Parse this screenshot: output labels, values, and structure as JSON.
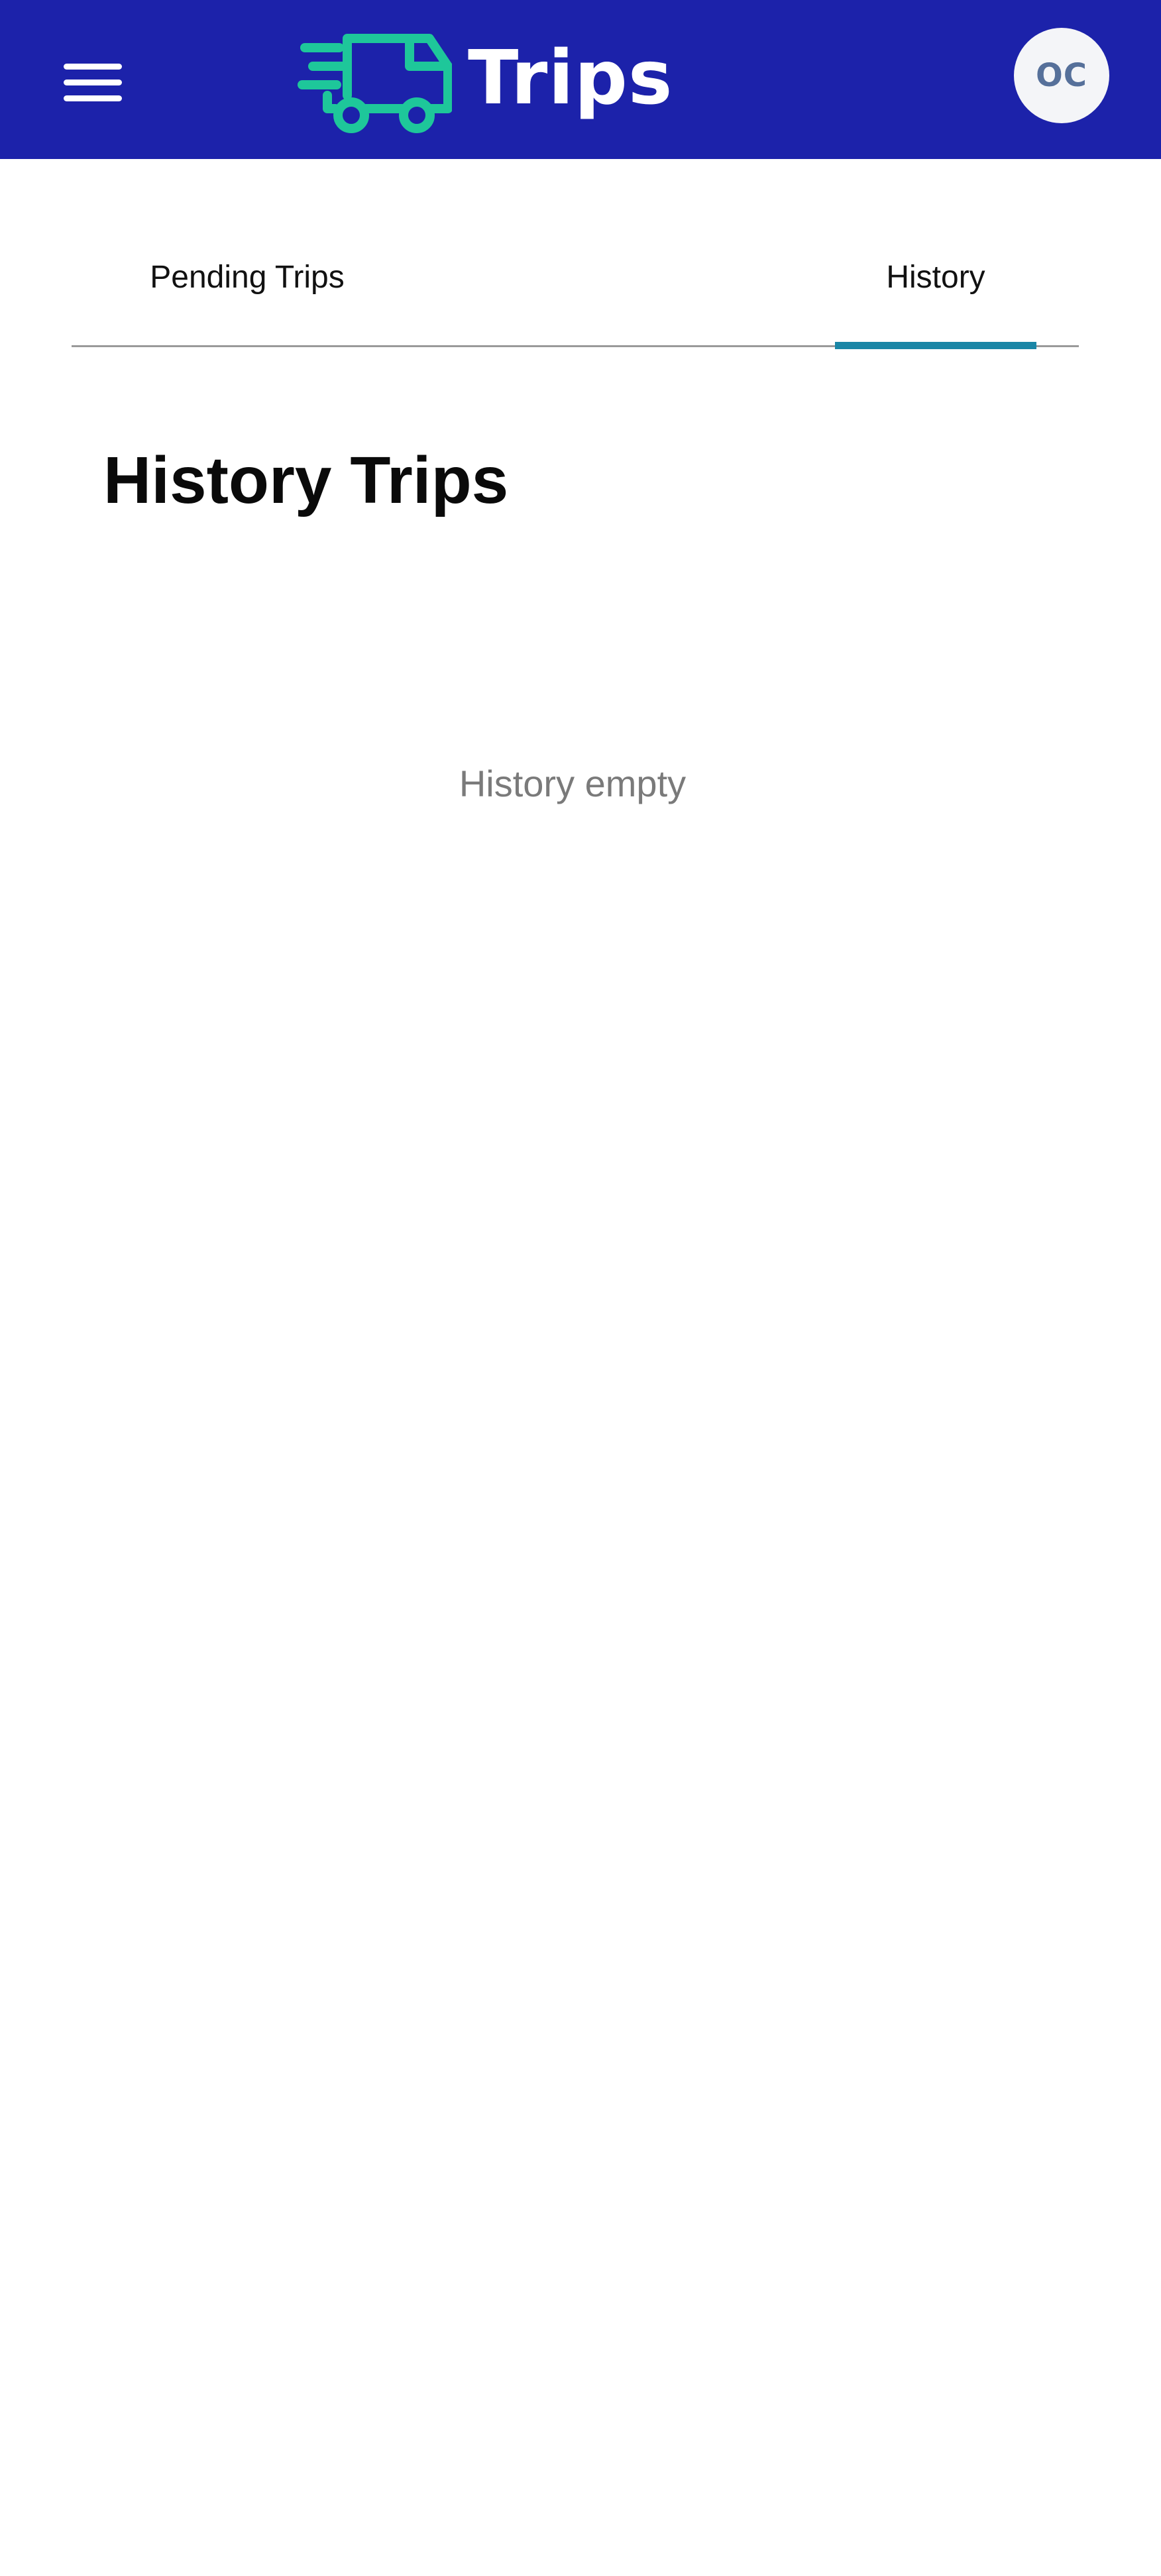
{
  "header": {
    "title": "Trips",
    "menu_icon": "hamburger-menu-icon",
    "logo_icon": "delivery-truck-icon",
    "avatar_initials": "OC",
    "colors": {
      "background": "#1c22aa",
      "logo": "#1ec79a",
      "avatar_background": "#f4f5f8",
      "avatar_text": "#56709a"
    }
  },
  "tabs": [
    {
      "label": "Pending Trips",
      "active": false
    },
    {
      "label": "History",
      "active": true
    }
  ],
  "tab_indicator_color": "#1a86a6",
  "main": {
    "title": "History Trips",
    "empty_message": "History empty"
  }
}
